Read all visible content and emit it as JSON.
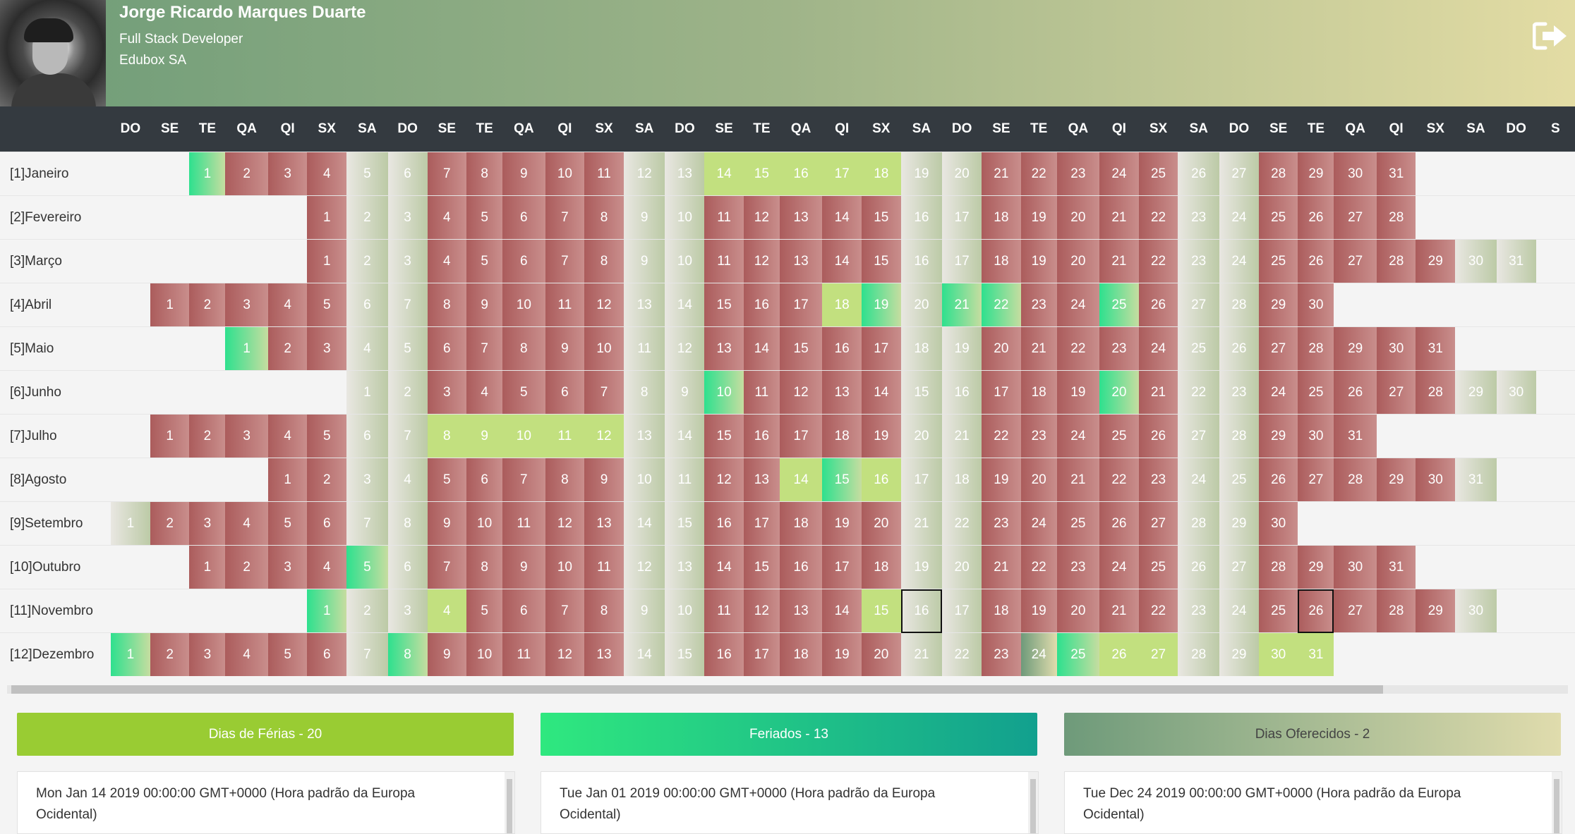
{
  "profile": {
    "name": "Jorge Ricardo Marques Duarte",
    "job_title": "Full Stack Developer",
    "company": "Edubox SA"
  },
  "weekday_headers": [
    "DO",
    "SE",
    "TE",
    "QA",
    "QI",
    "SX",
    "SA",
    "DO",
    "SE",
    "TE",
    "QA",
    "QI",
    "SX",
    "SA",
    "DO",
    "SE",
    "TE",
    "QA",
    "QI",
    "SX",
    "SA",
    "DO",
    "SE",
    "TE",
    "QA",
    "QI",
    "SX",
    "SA",
    "DO",
    "SE",
    "TE",
    "QA",
    "QI",
    "SX",
    "SA",
    "DO",
    "S"
  ],
  "months": [
    {
      "label": "[1]Janeiro",
      "start": 2,
      "days": 31,
      "vacation": [
        14,
        15,
        16,
        17,
        18
      ],
      "holidays": [
        1
      ],
      "offered": []
    },
    {
      "label": "[2]Fevereiro",
      "start": 5,
      "days": 28,
      "vacation": [],
      "holidays": [],
      "offered": []
    },
    {
      "label": "[3]Março",
      "start": 5,
      "days": 31,
      "vacation": [],
      "holidays": [],
      "offered": []
    },
    {
      "label": "[4]Abril",
      "start": 1,
      "days": 30,
      "vacation": [
        18
      ],
      "holidays": [
        19,
        21,
        22,
        25
      ],
      "offered": []
    },
    {
      "label": "[5]Maio",
      "start": 3,
      "days": 31,
      "vacation": [],
      "holidays": [
        1
      ],
      "offered": []
    },
    {
      "label": "[6]Junho",
      "start": 6,
      "days": 30,
      "vacation": [],
      "holidays": [
        10,
        20
      ],
      "offered": []
    },
    {
      "label": "[7]Julho",
      "start": 1,
      "days": 31,
      "vacation": [
        8,
        9,
        10,
        11,
        12
      ],
      "holidays": [],
      "offered": []
    },
    {
      "label": "[8]Agosto",
      "start": 4,
      "days": 31,
      "vacation": [
        14,
        16
      ],
      "holidays": [
        15
      ],
      "offered": []
    },
    {
      "label": "[9]Setembro",
      "start": 0,
      "days": 30,
      "vacation": [],
      "holidays": [],
      "offered": []
    },
    {
      "label": "[10]Outubro",
      "start": 2,
      "days": 31,
      "vacation": [],
      "holidays": [
        5
      ],
      "offered": []
    },
    {
      "label": "[11]Novembro",
      "start": 5,
      "days": 30,
      "vacation": [
        4,
        15
      ],
      "holidays": [
        1
      ],
      "offered": [],
      "selected": [
        16,
        26
      ]
    },
    {
      "label": "[12]Dezembro",
      "start": 0,
      "days": 31,
      "vacation": [
        26,
        27,
        30,
        31
      ],
      "holidays": [
        1,
        8,
        25
      ],
      "offered": [
        24
      ]
    }
  ],
  "summary": {
    "vacation_label": "Dias de Férias - 20",
    "holidays_label": "Feriados - 13",
    "offered_label": "Dias Oferecidos - 2",
    "vacation_first": "Mon Jan 14 2019 00:00:00 GMT+0000 (Hora padrão da Europa Ocidental)",
    "holidays_first": "Tue Jan 01 2019 00:00:00 GMT+0000 (Hora padrão da Europa Ocidental)",
    "offered_first": "Tue Dec 24 2019 00:00:00 GMT+0000 (Hora padrão da Europa Ocidental)"
  },
  "icons": {
    "logout": "sign-out-icon"
  }
}
